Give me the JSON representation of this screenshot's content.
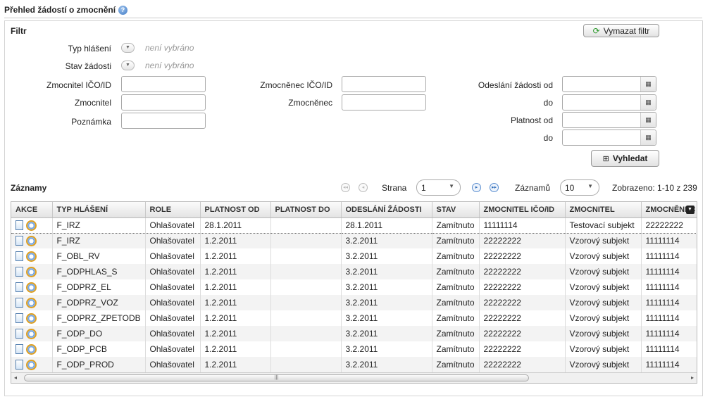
{
  "page": {
    "title": "Přehled žádostí o zmocnění",
    "help_icon": "question-icon"
  },
  "filter": {
    "heading": "Filtr",
    "clear_button": "Vymazat filtr",
    "typ_hlaseni": {
      "label": "Typ hlášení",
      "value": "není vybráno"
    },
    "stav_zadosti": {
      "label": "Stav žádosti",
      "value": "není vybráno"
    },
    "zmocnitel_ico": {
      "label": "Zmocnitel IČO/ID",
      "value": ""
    },
    "zmocnitel": {
      "label": "Zmocnitel",
      "value": ""
    },
    "poznamka": {
      "label": "Poznámka",
      "value": ""
    },
    "zmocnenec_ico": {
      "label": "Zmocněnec IČO/ID",
      "value": ""
    },
    "zmocnenec": {
      "label": "Zmocněnec",
      "value": ""
    },
    "odeslani_od": {
      "label": "Odeslání žádosti od",
      "value": ""
    },
    "odeslani_do": {
      "label": "do",
      "value": ""
    },
    "platnost_od": {
      "label": "Platnost od",
      "value": ""
    },
    "platnost_do": {
      "label": "do",
      "value": ""
    },
    "search_button": "Vyhledat"
  },
  "records": {
    "heading": "Záznamy",
    "page_label": "Strana",
    "page_value": "1",
    "count_label": "Záznamů",
    "count_value": "10",
    "shown_text": "Zobrazeno: 1-10 z 239"
  },
  "table": {
    "columns": [
      "AKCE",
      "TYP HLÁŠENÍ",
      "ROLE",
      "PLATNOST OD",
      "PLATNOST DO",
      "ODESLÁNÍ ŽÁDOSTI",
      "STAV",
      "ZMOCNITEL IČO/ID",
      "ZMOCNITEL",
      "ZMOCNĚNEC"
    ],
    "rows": [
      [
        "F_IRZ",
        "Ohlašovatel",
        "28.1.2011",
        "",
        "28.1.2011",
        "Zamítnuto",
        "11111114",
        "Testovací subjekt",
        "22222222"
      ],
      [
        "F_IRZ",
        "Ohlašovatel",
        "1.2.2011",
        "",
        "3.2.2011",
        "Zamítnuto",
        "22222222",
        "Vzorový subjekt",
        "11111114"
      ],
      [
        "F_OBL_RV",
        "Ohlašovatel",
        "1.2.2011",
        "",
        "3.2.2011",
        "Zamítnuto",
        "22222222",
        "Vzorový subjekt",
        "11111114"
      ],
      [
        "F_ODPHLAS_S",
        "Ohlašovatel",
        "1.2.2011",
        "",
        "3.2.2011",
        "Zamítnuto",
        "22222222",
        "Vzorový subjekt",
        "11111114"
      ],
      [
        "F_ODPRZ_EL",
        "Ohlašovatel",
        "1.2.2011",
        "",
        "3.2.2011",
        "Zamítnuto",
        "22222222",
        "Vzorový subjekt",
        "11111114"
      ],
      [
        "F_ODPRZ_VOZ",
        "Ohlašovatel",
        "1.2.2011",
        "",
        "3.2.2011",
        "Zamítnuto",
        "22222222",
        "Vzorový subjekt",
        "11111114"
      ],
      [
        "F_ODPRZ_ZPETODB",
        "Ohlašovatel",
        "1.2.2011",
        "",
        "3.2.2011",
        "Zamítnuto",
        "22222222",
        "Vzorový subjekt",
        "11111114"
      ],
      [
        "F_ODP_DO",
        "Ohlašovatel",
        "1.2.2011",
        "",
        "3.2.2011",
        "Zamítnuto",
        "22222222",
        "Vzorový subjekt",
        "11111114"
      ],
      [
        "F_ODP_PCB",
        "Ohlašovatel",
        "1.2.2011",
        "",
        "3.2.2011",
        "Zamítnuto",
        "22222222",
        "Vzorový subjekt",
        "11111114"
      ],
      [
        "F_ODP_PROD",
        "Ohlašovatel",
        "1.2.2011",
        "",
        "3.2.2011",
        "Zamítnuto",
        "22222222",
        "Vzorový subjekt",
        "11111114"
      ]
    ]
  }
}
